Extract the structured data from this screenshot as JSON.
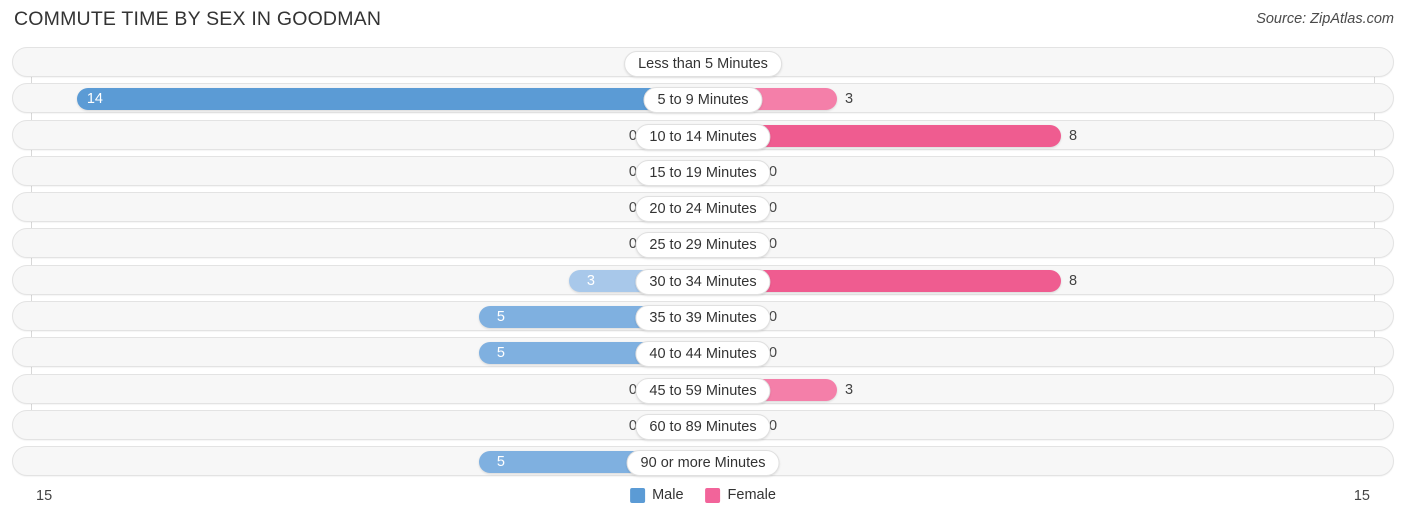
{
  "header": {
    "title": "COMMUTE TIME BY SEX IN GOODMAN",
    "source": "Source: ZipAtlas.com"
  },
  "footer": {
    "axis_left": "15",
    "axis_right": "15",
    "legend": [
      {
        "label": "Male",
        "color": "#5b9bd5"
      },
      {
        "label": "Female",
        "color": "#f2649a"
      }
    ]
  },
  "colors": {
    "male_strong": "#5b9bd5",
    "male_mid": "#7fb0e0",
    "male_light": "#a8c8ea",
    "female_strong": "#ef5c90",
    "female_mid": "#f47fa9",
    "female_light": "#f5a0bf",
    "track_fill": "#f7f7f7",
    "track_border": "#e3e3e3",
    "gridline": "#d8d8d8"
  },
  "chart_data": {
    "type": "bar",
    "orientation": "horizontal-diverging",
    "title": "COMMUTE TIME BY SEX IN GOODMAN",
    "xlabel": "",
    "ylabel": "",
    "axis_max": 15,
    "xlim": [
      15,
      15
    ],
    "grid": true,
    "legend_position": "bottom-center",
    "categories": [
      "Less than 5 Minutes",
      "5 to 9 Minutes",
      "10 to 14 Minutes",
      "15 to 19 Minutes",
      "20 to 24 Minutes",
      "25 to 29 Minutes",
      "30 to 34 Minutes",
      "35 to 39 Minutes",
      "40 to 44 Minutes",
      "45 to 59 Minutes",
      "60 to 89 Minutes",
      "90 or more Minutes"
    ],
    "series": [
      {
        "name": "Male",
        "values": [
          0,
          14,
          0,
          0,
          0,
          0,
          3,
          5,
          5,
          0,
          0,
          5
        ]
      },
      {
        "name": "Female",
        "values": [
          0,
          3,
          8,
          0,
          0,
          0,
          8,
          0,
          0,
          3,
          0,
          0
        ]
      }
    ]
  },
  "rows": [
    {
      "label": "Less than 5 Minutes",
      "male": "0",
      "female": "0"
    },
    {
      "label": "5 to 9 Minutes",
      "male": "14",
      "female": "3"
    },
    {
      "label": "10 to 14 Minutes",
      "male": "0",
      "female": "8"
    },
    {
      "label": "15 to 19 Minutes",
      "male": "0",
      "female": "0"
    },
    {
      "label": "20 to 24 Minutes",
      "male": "0",
      "female": "0"
    },
    {
      "label": "25 to 29 Minutes",
      "male": "0",
      "female": "0"
    },
    {
      "label": "30 to 34 Minutes",
      "male": "3",
      "female": "8"
    },
    {
      "label": "35 to 39 Minutes",
      "male": "5",
      "female": "0"
    },
    {
      "label": "40 to 44 Minutes",
      "male": "5",
      "female": "0"
    },
    {
      "label": "45 to 59 Minutes",
      "male": "0",
      "female": "3"
    },
    {
      "label": "60 to 89 Minutes",
      "male": "0",
      "female": "0"
    },
    {
      "label": "90 or more Minutes",
      "male": "5",
      "female": "0"
    }
  ]
}
